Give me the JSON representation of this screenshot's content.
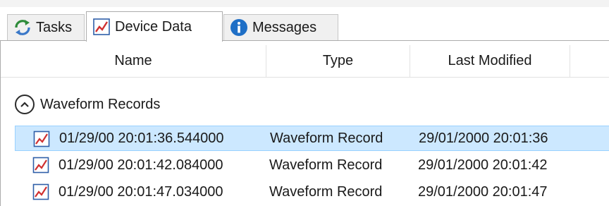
{
  "tabs": [
    {
      "label": "Tasks",
      "icon": "refresh-arrows-icon"
    },
    {
      "label": "Device Data",
      "icon": "line-chart-icon",
      "active": true
    },
    {
      "label": "Messages",
      "icon": "info-icon"
    }
  ],
  "columns": {
    "name": "Name",
    "type": "Type",
    "modified": "Last Modified"
  },
  "group": {
    "label": "Waveform Records",
    "icon": "collapse-chevron-up-icon"
  },
  "rows": [
    {
      "name": "01/29/00 20:01:36.544000",
      "type": "Waveform Record",
      "modified": "29/01/2000 20:01:36",
      "selected": true
    },
    {
      "name": "01/29/00 20:01:42.084000",
      "type": "Waveform Record",
      "modified": "29/01/2000 20:01:42",
      "selected": false
    },
    {
      "name": "01/29/00 20:01:47.034000",
      "type": "Waveform Record",
      "modified": "29/01/2000 20:01:47",
      "selected": false
    }
  ],
  "colors": {
    "selection_bg": "#cce8ff",
    "selection_border": "#99d1ff",
    "chart_icon_red": "#d03030",
    "chart_icon_frame": "#2f5fa8",
    "info_blue": "#1f6fc6"
  }
}
